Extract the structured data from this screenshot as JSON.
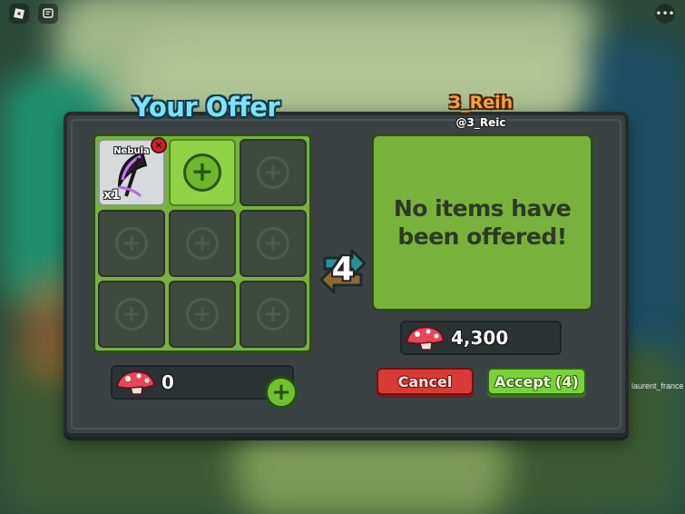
{
  "top_bar": {
    "roblox_icon": "roblox-logo-icon",
    "chat_icon": "chat-icon",
    "menu_icon": "more-options-icon"
  },
  "background": {
    "player_name_tag": "laurent_france"
  },
  "your_offer": {
    "title": "Your Offer",
    "slots": [
      {
        "type": "item",
        "name": "Nebula",
        "quantity": "x1",
        "remove_icon": "remove-x-icon"
      },
      {
        "type": "add"
      },
      {
        "type": "empty"
      },
      {
        "type": "empty"
      },
      {
        "type": "empty"
      },
      {
        "type": "empty"
      },
      {
        "type": "empty"
      },
      {
        "type": "empty"
      },
      {
        "type": "empty"
      }
    ],
    "currency_amount": "0",
    "currency_icon": "mushroom-icon"
  },
  "swap": {
    "count": "4",
    "icon": "swap-arrows-icon"
  },
  "other_player": {
    "display_name": "3_Reih",
    "username": "@3_Reic",
    "empty_message": "No items have been offered!",
    "currency_amount": "4,300",
    "currency_icon": "mushroom-icon"
  },
  "actions": {
    "cancel_label": "Cancel",
    "accept_label": "Accept (4)"
  },
  "colors": {
    "offer_green": "#78b23c",
    "title_cyan": "#7fe2f4",
    "name_orange": "#f6a23a",
    "cancel_red": "#d83a35",
    "accept_green": "#7ad13a",
    "window_gray": "#3a4243"
  }
}
